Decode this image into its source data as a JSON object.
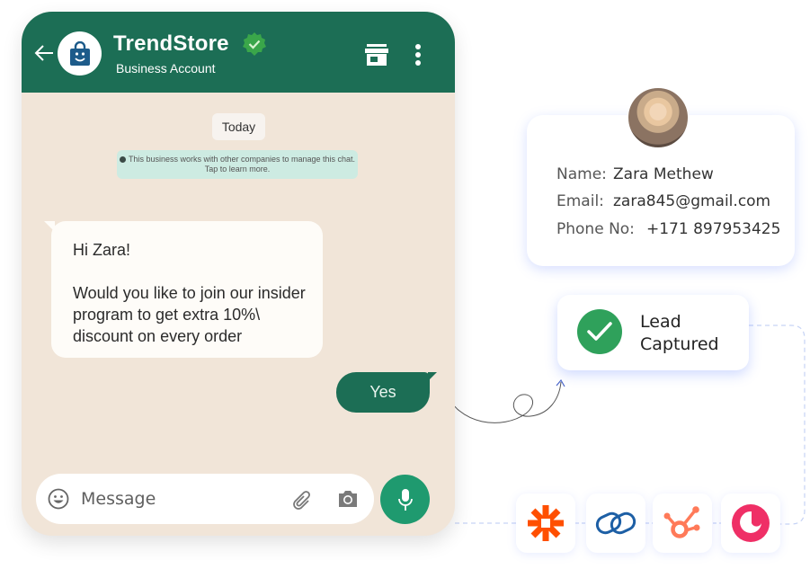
{
  "chat": {
    "store_name": "TrendStore",
    "account_type": "Business Account",
    "date_label": "Today",
    "notice": "This business works with other companies to manage this chat. Tap to learn more.",
    "incoming_message": {
      "greeting": "Hi Zara!",
      "body": "Would you like to join our insider program to get extra 10%\\ discount on every order"
    },
    "outgoing_message": "Yes",
    "input_placeholder": "Message",
    "colors": {
      "header": "#1c6e55",
      "background": "#f1e5d8",
      "mic": "#1f9a6f",
      "verified": "#3aa64a"
    },
    "icons": [
      "back-arrow-icon",
      "shopping-bag-icon",
      "verified-badge-icon",
      "store-icon",
      "more-vertical-icon",
      "emoji-icon",
      "attach-icon",
      "camera-icon",
      "mic-icon"
    ]
  },
  "contact": {
    "name_label": "Name:",
    "name": "Zara Methew",
    "email_label": "Email:",
    "email": "zara845@gmail.com",
    "phone_label": "Phone No:",
    "phone": "+171 897953425"
  },
  "lead": {
    "line1": "Lead",
    "line2": "Captured",
    "color": "#2fa15b"
  },
  "integrations": [
    {
      "name": "zapier",
      "icon": "zapier-asterisk-icon",
      "color": "#ff4f00"
    },
    {
      "name": "zoho",
      "icon": "linked-rings-icon",
      "color": "#1d5fa5"
    },
    {
      "name": "hubspot",
      "icon": "hubspot-sprocket-icon",
      "color": "#ff7a59"
    },
    {
      "name": "crm",
      "icon": "pink-circle-logo-icon",
      "color": "#ef2f66"
    }
  ]
}
